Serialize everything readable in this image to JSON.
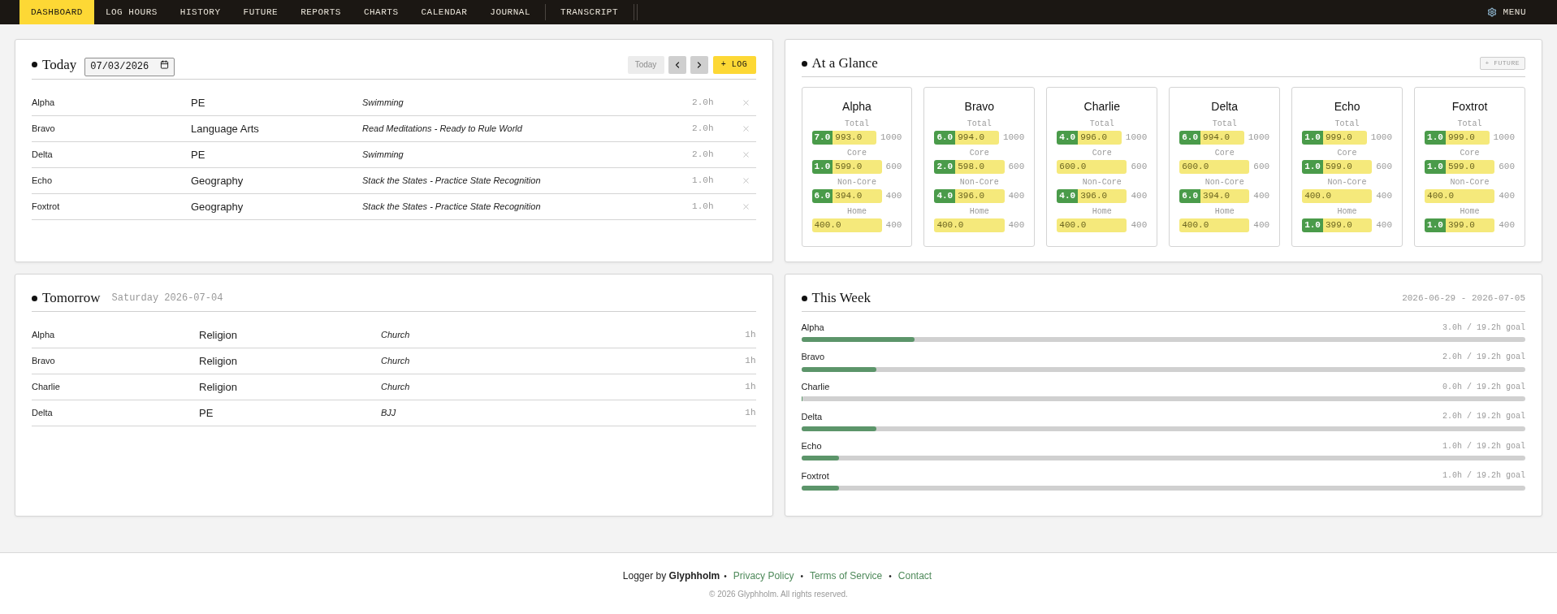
{
  "nav": {
    "items": [
      {
        "label": "DASHBOARD",
        "selected": true
      },
      {
        "label": "LOG HOURS",
        "selected": false
      },
      {
        "label": "HISTORY",
        "selected": false
      },
      {
        "label": "FUTURE",
        "selected": false
      },
      {
        "label": "REPORTS",
        "selected": false
      },
      {
        "label": "CHARTS",
        "selected": false
      },
      {
        "label": "CALENDAR",
        "selected": false
      },
      {
        "label": "JOURNAL",
        "selected": false
      },
      {
        "label": "TRANSCRIPT",
        "selected": false
      }
    ],
    "menu": "MENU"
  },
  "today": {
    "title": "Today",
    "date": "07/03/2026",
    "today_button": {
      "label": "Today",
      "disabled": true
    },
    "log_button": "+ LOG",
    "entries": [
      {
        "name": "Alpha",
        "subject": "PE",
        "activity": "Swimming",
        "hours": "2.0h"
      },
      {
        "name": "Bravo",
        "subject": "Language Arts",
        "activity": "Read Meditations - Ready to Rule World",
        "hours": "2.0h"
      },
      {
        "name": "Delta",
        "subject": "PE",
        "activity": "Swimming",
        "hours": "2.0h"
      },
      {
        "name": "Echo",
        "subject": "Geography",
        "activity": "Stack the States - Practice State Recognition",
        "hours": "1.0h"
      },
      {
        "name": "Foxtrot",
        "subject": "Geography",
        "activity": "Stack the States - Practice State Recognition",
        "hours": "1.0h"
      }
    ]
  },
  "glance": {
    "title": "At a Glance",
    "future_button": "+ FUTURE",
    "students": [
      {
        "name": "Alpha",
        "categories": [
          {
            "label": "Total",
            "done": "7.0",
            "remaining": "993.0",
            "limit": "1000"
          },
          {
            "label": "Core",
            "done": "1.0",
            "remaining": "599.0",
            "limit": "600"
          },
          {
            "label": "Non-Core",
            "done": "6.0",
            "remaining": "394.0",
            "limit": "400"
          },
          {
            "label": "Home",
            "remaining": "400.0",
            "limit": "400"
          }
        ]
      },
      {
        "name": "Bravo",
        "categories": [
          {
            "label": "Total",
            "done": "6.0",
            "remaining": "994.0",
            "limit": "1000"
          },
          {
            "label": "Core",
            "done": "2.0",
            "remaining": "598.0",
            "limit": "600"
          },
          {
            "label": "Non-Core",
            "done": "4.0",
            "remaining": "396.0",
            "limit": "400"
          },
          {
            "label": "Home",
            "remaining": "400.0",
            "limit": "400"
          }
        ]
      },
      {
        "name": "Charlie",
        "categories": [
          {
            "label": "Total",
            "done": "4.0",
            "remaining": "996.0",
            "limit": "1000"
          },
          {
            "label": "Core",
            "remaining": "600.0",
            "limit": "600"
          },
          {
            "label": "Non-Core",
            "done": "4.0",
            "remaining": "396.0",
            "limit": "400"
          },
          {
            "label": "Home",
            "remaining": "400.0",
            "limit": "400"
          }
        ]
      },
      {
        "name": "Delta",
        "categories": [
          {
            "label": "Total",
            "done": "6.0",
            "remaining": "994.0",
            "limit": "1000"
          },
          {
            "label": "Core",
            "remaining": "600.0",
            "limit": "600"
          },
          {
            "label": "Non-Core",
            "done": "6.0",
            "remaining": "394.0",
            "limit": "400"
          },
          {
            "label": "Home",
            "remaining": "400.0",
            "limit": "400"
          }
        ]
      },
      {
        "name": "Echo",
        "categories": [
          {
            "label": "Total",
            "done": "1.0",
            "remaining": "999.0",
            "limit": "1000"
          },
          {
            "label": "Core",
            "done": "1.0",
            "remaining": "599.0",
            "limit": "600"
          },
          {
            "label": "Non-Core",
            "remaining": "400.0",
            "limit": "400"
          },
          {
            "label": "Home",
            "done": "1.0",
            "remaining": "399.0",
            "limit": "400"
          }
        ]
      },
      {
        "name": "Foxtrot",
        "categories": [
          {
            "label": "Total",
            "done": "1.0",
            "remaining": "999.0",
            "limit": "1000"
          },
          {
            "label": "Core",
            "done": "1.0",
            "remaining": "599.0",
            "limit": "600"
          },
          {
            "label": "Non-Core",
            "remaining": "400.0",
            "limit": "400"
          },
          {
            "label": "Home",
            "done": "1.0",
            "remaining": "399.0",
            "limit": "400"
          }
        ]
      }
    ]
  },
  "tomorrow": {
    "title": "Tomorrow",
    "date": "Saturday 2026-07-04",
    "entries": [
      {
        "name": "Alpha",
        "subject": "Religion",
        "activity": "Church",
        "hours": "1h"
      },
      {
        "name": "Bravo",
        "subject": "Religion",
        "activity": "Church",
        "hours": "1h"
      },
      {
        "name": "Charlie",
        "subject": "Religion",
        "activity": "Church",
        "hours": "1h"
      },
      {
        "name": "Delta",
        "subject": "PE",
        "activity": "BJJ",
        "hours": "1h"
      }
    ]
  },
  "week": {
    "title": "This Week",
    "range": "2026-06-29 - 2026-07-05",
    "students": [
      {
        "name": "Alpha",
        "reading": "3.0h / 19.2h goal",
        "level": 0.156
      },
      {
        "name": "Bravo",
        "reading": "2.0h / 19.2h goal",
        "level": 0.104
      },
      {
        "name": "Charlie",
        "reading": "0.0h / 19.2h goal",
        "level": 0
      },
      {
        "name": "Delta",
        "reading": "2.0h / 19.2h goal",
        "level": 0.104
      },
      {
        "name": "Echo",
        "reading": "1.0h / 19.2h goal",
        "level": 0.052
      },
      {
        "name": "Foxtrot",
        "reading": "1.0h / 19.2h goal",
        "level": 0.052
      }
    ]
  },
  "footer": {
    "credit": "Logger by **Glyphholm**",
    "links": [
      {
        "separator": "•",
        "label": "Privacy Policy"
      },
      {
        "separator": "•",
        "label": "Terms of Service"
      },
      {
        "separator": "•",
        "label": "Contact"
      }
    ],
    "copyright": "© 2026 Glyphholm. All rights reserved."
  }
}
